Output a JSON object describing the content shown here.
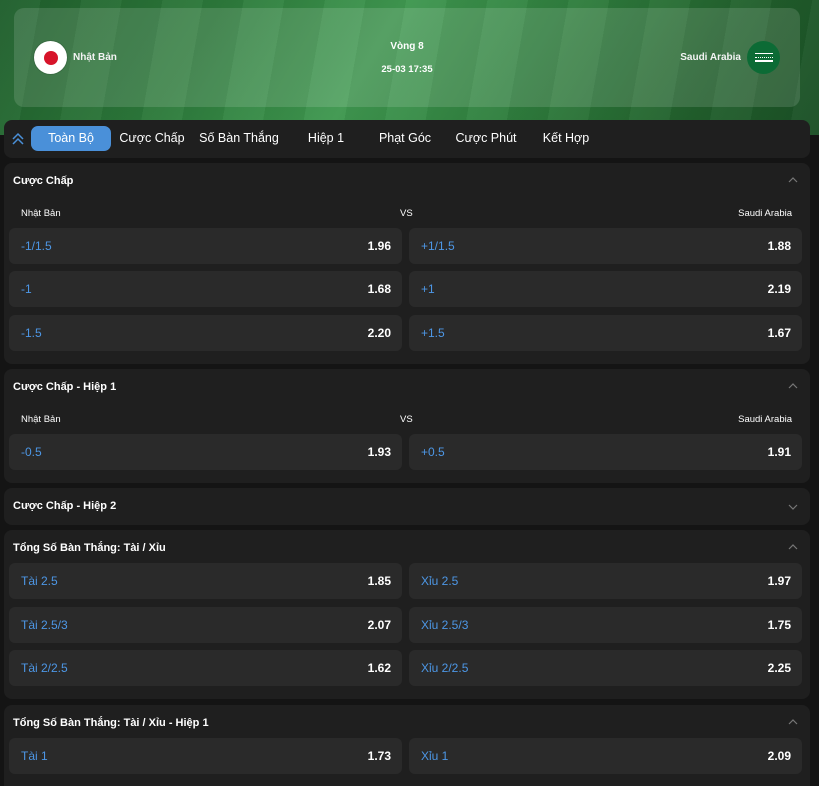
{
  "match": {
    "home_team": "Nhật Bản",
    "away_team": "Saudi Arabia",
    "round": "Vòng 8",
    "datetime": "25-03 17:35"
  },
  "tabs": [
    {
      "label": "Toàn Bộ",
      "active": true
    },
    {
      "label": "Cược Chấp",
      "active": false
    },
    {
      "label": "Số Bàn Thắng",
      "active": false
    },
    {
      "label": "Hiệp 1",
      "active": false
    },
    {
      "label": "Phạt Góc",
      "active": false
    },
    {
      "label": "Cược Phút",
      "active": false
    },
    {
      "label": "Kết Hợp",
      "active": false
    }
  ],
  "sections": {
    "handicap": {
      "title": "Cược Chấp",
      "home": "Nhật Bản",
      "vs": "VS",
      "away": "Saudi Arabia",
      "rows": [
        {
          "left_label": "-1/1.5",
          "left_odd": "1.96",
          "right_label": "+1/1.5",
          "right_odd": "1.88"
        },
        {
          "left_label": "-1",
          "left_odd": "1.68",
          "right_label": "+1",
          "right_odd": "2.19"
        },
        {
          "left_label": "-1.5",
          "left_odd": "2.20",
          "right_label": "+1.5",
          "right_odd": "1.67"
        }
      ]
    },
    "handicap_h1": {
      "title": "Cược Chấp - Hiệp 1",
      "home": "Nhật Bản",
      "vs": "VS",
      "away": "Saudi Arabia",
      "rows": [
        {
          "left_label": "-0.5",
          "left_odd": "1.93",
          "right_label": "+0.5",
          "right_odd": "1.91"
        }
      ]
    },
    "handicap_h2": {
      "title": "Cược Chấp - Hiệp 2"
    },
    "total_goals": {
      "title": "Tổng Số Bàn Thắng: Tài / Xỉu",
      "rows": [
        {
          "left_label": "Tài 2.5",
          "left_odd": "1.85",
          "right_label": "Xỉu 2.5",
          "right_odd": "1.97"
        },
        {
          "left_label": "Tài 2.5/3",
          "left_odd": "2.07",
          "right_label": "Xỉu 2.5/3",
          "right_odd": "1.75"
        },
        {
          "left_label": "Tài 2/2.5",
          "left_odd": "1.62",
          "right_label": "Xỉu 2/2.5",
          "right_odd": "2.25"
        }
      ]
    },
    "total_goals_h1": {
      "title": "Tổng Số Bàn Thắng: Tài / Xỉu - Hiệp 1",
      "rows": [
        {
          "left_label": "Tài 1",
          "left_odd": "1.73",
          "right_label": "Xỉu 1",
          "right_odd": "2.09"
        }
      ]
    }
  },
  "colors": {
    "accent": "#4a90d9",
    "label_blue": "#4d97e6",
    "panel": "#1f1f1f",
    "cell": "#2a2a2a",
    "background": "#141414"
  }
}
